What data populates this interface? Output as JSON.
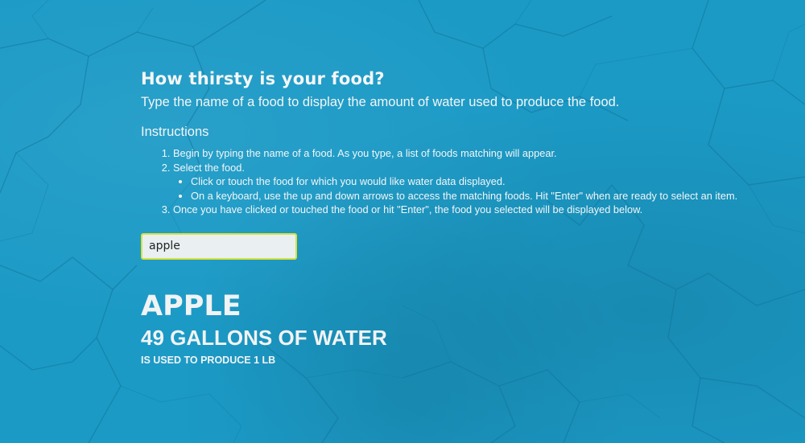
{
  "page": {
    "heading": "How thirsty is your food?",
    "subheading": "Type the name of a food to display the amount of water used to produce the food.",
    "instructions_title": "Instructions",
    "steps": [
      "Begin by typing the name of a food. As you type, a list of foods matching will appear.",
      "Select the food.",
      "Once you have clicked or touched the food or hit \"Enter\", the food you selected will be displayed below."
    ],
    "substeps": [
      "Click or touch the food for which you would like water data displayed.",
      "On a keyboard, use the up and down arrows to access the matching foods. Hit \"Enter\" when are ready to select an item."
    ]
  },
  "search": {
    "value": "apple",
    "placeholder": ""
  },
  "result": {
    "food": "APPLE",
    "amount": "49 GALLONS OF WATER",
    "caption": "IS USED TO PRODUCE 1 LB"
  },
  "colors": {
    "background": "#1b9ac6",
    "input_border": "#d9e23a",
    "text": "#ffffff"
  }
}
